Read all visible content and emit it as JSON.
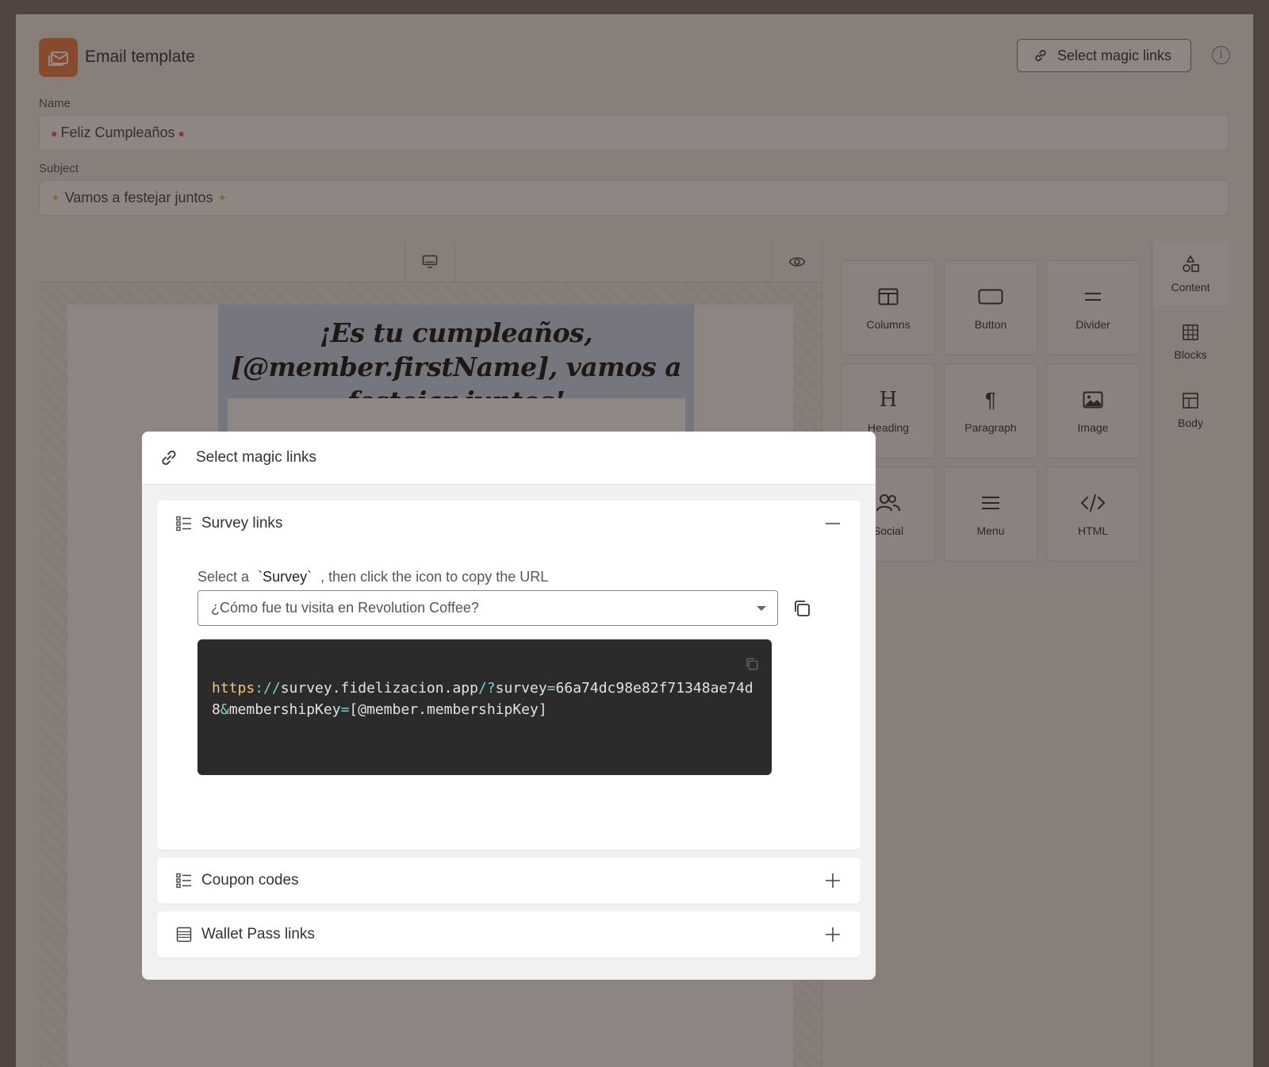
{
  "header": {
    "title": "Email template",
    "magic_links_button": "Select magic links",
    "info_icon": "i"
  },
  "form": {
    "name_label": "Name",
    "name_value": "Feliz Cumpleaños",
    "subject_label": "Subject",
    "subject_value": "Vamos a festejar juntos"
  },
  "email_preview": {
    "title": "¡Es tu cumpleaños, [@member.firstName], vamos a festejar juntos!"
  },
  "tools": [
    {
      "label": "Columns",
      "icon": "columns-icon"
    },
    {
      "label": "Button",
      "icon": "button-icon"
    },
    {
      "label": "Divider",
      "icon": "divider-icon"
    },
    {
      "label": "Heading",
      "icon": "heading-icon"
    },
    {
      "label": "Paragraph",
      "icon": "paragraph-icon"
    },
    {
      "label": "Image",
      "icon": "image-icon"
    },
    {
      "label": "Social",
      "icon": "social-icon"
    },
    {
      "label": "Menu",
      "icon": "menu-icon"
    },
    {
      "label": "HTML",
      "icon": "html-icon"
    }
  ],
  "side_tabs": [
    {
      "label": "Content",
      "icon": "shapes-icon",
      "active": true
    },
    {
      "label": "Blocks",
      "icon": "blocks-icon",
      "active": false
    },
    {
      "label": "Body",
      "icon": "body-layout-icon",
      "active": false
    }
  ],
  "modal": {
    "title": "Select magic links",
    "survey_panel": {
      "title": "Survey links",
      "expanded": true,
      "hint_prefix": "Select a",
      "hint_code": "`Survey`",
      "hint_suffix": ", then click the icon to copy the URL",
      "selected_survey": "¿Cómo fue tu visita en Revolution Coffee?",
      "url": {
        "scheme": "https",
        "sep": "://",
        "host": "survey.fidelizacion.app",
        "path": "/?",
        "param1": "survey",
        "eq1": "=",
        "value1": "66a74dc98e82f71348ae74d8",
        "amp": "&",
        "param2": "membershipKey",
        "eq2": "=",
        "value2": "[@member.membershipKey]"
      }
    },
    "coupon_panel": {
      "title": "Coupon codes",
      "expanded": false
    },
    "wallet_panel": {
      "title": "Wallet Pass links",
      "expanded": false
    }
  },
  "colors": {
    "brand_orange": "#e47a44",
    "code_bg": "#2b2b2b",
    "code_scheme": "#f0c674",
    "code_punct": "#7fcfcf"
  }
}
